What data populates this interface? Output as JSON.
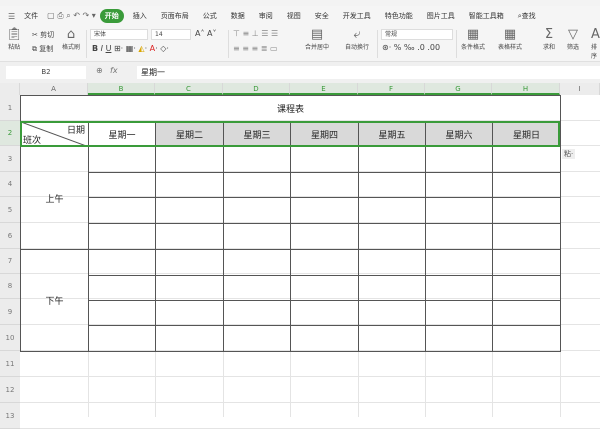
{
  "menu": {
    "file": "文件",
    "tabs": [
      "开始",
      "插入",
      "页面布局",
      "公式",
      "数据",
      "审阅",
      "视图",
      "安全",
      "开发工具",
      "特色功能",
      "图片工具",
      "智能工具箱"
    ],
    "active": "开始",
    "search": "查找"
  },
  "ribbon": {
    "paste": "粘贴",
    "cut": "剪切",
    "copy": "复制",
    "format_painter": "格式刷",
    "font": "宋体",
    "size": "14",
    "merge": "合并居中",
    "wrap": "自动换行",
    "number_format": "常规",
    "cond_format": "条件格式",
    "table_style": "表格样式",
    "sum": "求和",
    "filter": "筛选",
    "sort": "排序"
  },
  "formula": {
    "cell": "B2",
    "fx": "fx",
    "value": "星期一"
  },
  "columns": [
    "A",
    "B",
    "C",
    "D",
    "E",
    "F",
    "G",
    "H",
    "I"
  ],
  "rows": [
    "1",
    "2",
    "3",
    "4",
    "5",
    "6",
    "7",
    "8",
    "9",
    "10",
    "11",
    "12",
    "13"
  ],
  "sheet": {
    "title": "课程表",
    "corner_top": "日期",
    "corner_bottom": "班次",
    "days": [
      "星期一",
      "星期二",
      "星期三",
      "星期四",
      "星期五",
      "星期六",
      "星期日"
    ],
    "morning": "上午",
    "afternoon": "下午"
  },
  "paste_options": "粘·"
}
